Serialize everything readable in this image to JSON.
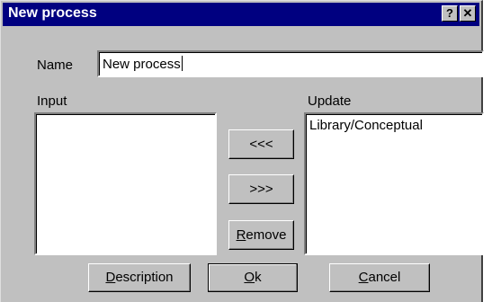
{
  "window": {
    "title": "New process",
    "help_label": "?",
    "close_label": "✕"
  },
  "form": {
    "name_label": "Name",
    "name_value": "New process",
    "input_label": "Input",
    "update_label": "Update",
    "input_items": [],
    "update_items": [
      "Library/Conceptual"
    ]
  },
  "buttons": {
    "move_left": "<<<",
    "move_right": ">>>",
    "remove": {
      "first": "R",
      "rest": "emove"
    },
    "description": {
      "first": "D",
      "rest": "escription"
    },
    "ok": {
      "first": "O",
      "rest": "k"
    },
    "cancel": {
      "first": "C",
      "rest": "ancel"
    }
  }
}
